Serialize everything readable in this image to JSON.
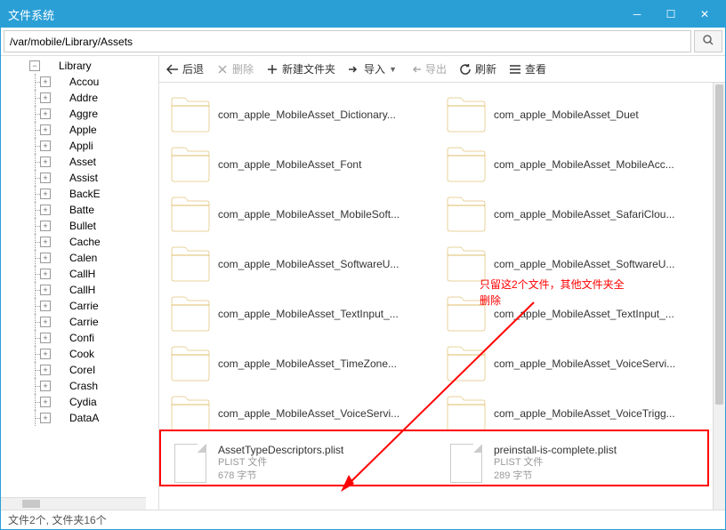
{
  "window": {
    "title": "文件系统"
  },
  "address": {
    "path": "/var/mobile/Library/Assets"
  },
  "toolbar": {
    "back": "后退",
    "delete": "删除",
    "newfolder": "新建文件夹",
    "import": "导入",
    "export": "导出",
    "refresh": "刷新",
    "view": "查看"
  },
  "tree": {
    "root": "Library",
    "items": [
      "Accou",
      "Addre",
      "Aggre",
      "Apple",
      "Appli",
      "Asset",
      "Assist",
      "BackE",
      "Batte",
      "Bullet",
      "Cache",
      "Calen",
      "CallH",
      "CallH",
      "Carrie",
      "Carrie",
      "Confi",
      "Cook",
      "CoreI",
      "Crash",
      "Cydia",
      "DataA"
    ]
  },
  "files": {
    "folders": [
      "com_apple_MobileAsset_Dictionary...",
      "com_apple_MobileAsset_Duet",
      "com_apple_MobileAsset_Font",
      "com_apple_MobileAsset_MobileAcc...",
      "com_apple_MobileAsset_MobileSoft...",
      "com_apple_MobileAsset_SafariClou...",
      "com_apple_MobileAsset_SoftwareU...",
      "com_apple_MobileAsset_SoftwareU...",
      "com_apple_MobileAsset_TextInput_...",
      "com_apple_MobileAsset_TextInput_...",
      "com_apple_MobileAsset_TimeZone...",
      "com_apple_MobileAsset_VoiceServi...",
      "com_apple_MobileAsset_VoiceServi...",
      "com_apple_MobileAsset_VoiceTrigg..."
    ],
    "plists": [
      {
        "name": "AssetTypeDescriptors.plist",
        "type": "PLIST 文件",
        "size": "678 字节"
      },
      {
        "name": "preinstall-is-complete.plist",
        "type": "PLIST 文件",
        "size": "289 字节"
      }
    ]
  },
  "annotation": {
    "line1": "只留这2个文件，其他文件夹全",
    "line2": "删除"
  },
  "status": {
    "text": "文件2个, 文件夹16个"
  }
}
